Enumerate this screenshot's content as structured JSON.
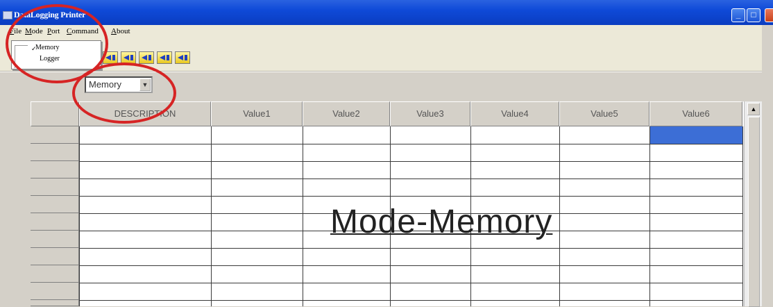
{
  "window": {
    "title": "DataLogging Printer"
  },
  "menu": {
    "items": [
      "File",
      "Mode",
      "Port",
      "Command",
      "About"
    ]
  },
  "mode_menu": {
    "items": [
      {
        "label": "Memory",
        "checked": true
      },
      {
        "label": "Logger",
        "checked": false
      }
    ],
    "check_mark": "✓"
  },
  "mode_select": {
    "value": "Memory",
    "arrow": "▼"
  },
  "table": {
    "columns": [
      "DESCRIPTION",
      "Value1",
      "Value2",
      "Value3",
      "Value4",
      "Value5",
      "Value6"
    ],
    "selected_cell": {
      "row": 1,
      "column": "Value6"
    }
  },
  "annotation": {
    "text": "Mode-Memory"
  },
  "colors": {
    "title_bar": "#0f4ad8",
    "highlight_circle": "#d62424",
    "selection": "#3c6ed6"
  },
  "icons": {
    "toolbar": [
      "arrow-left-icon",
      "arrow-left-icon",
      "arrow-left-icon",
      "arrow-left-icon"
    ],
    "scroll_up": "▲"
  }
}
